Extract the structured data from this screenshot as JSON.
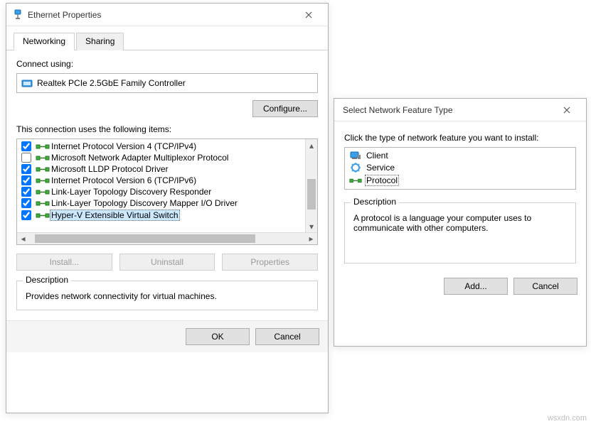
{
  "ethernet": {
    "title": "Ethernet Properties",
    "tabs": {
      "networking": "Networking",
      "sharing": "Sharing"
    },
    "connect_label": "Connect using:",
    "adapter": "Realtek PCIe 2.5GbE Family Controller",
    "configure_btn": "Configure...",
    "items_label": "This connection uses the following items:",
    "items": [
      {
        "checked": true,
        "name": "Internet Protocol Version 4 (TCP/IPv4)"
      },
      {
        "checked": false,
        "name": "Microsoft Network Adapter Multiplexor Protocol"
      },
      {
        "checked": true,
        "name": "Microsoft LLDP Protocol Driver"
      },
      {
        "checked": true,
        "name": "Internet Protocol Version 6 (TCP/IPv6)"
      },
      {
        "checked": true,
        "name": "Link-Layer Topology Discovery Responder"
      },
      {
        "checked": true,
        "name": "Link-Layer Topology Discovery Mapper I/O Driver"
      },
      {
        "checked": true,
        "name": "Hyper-V Extensible Virtual Switch",
        "selected": true
      }
    ],
    "install_btn": "Install...",
    "uninstall_btn": "Uninstall",
    "properties_btn": "Properties",
    "desc_group": "Description",
    "desc_text": "Provides network connectivity for virtual machines.",
    "ok_btn": "OK",
    "cancel_btn": "Cancel"
  },
  "select_feature": {
    "title": "Select Network Feature Type",
    "header": "Click the type of network feature you want to install:",
    "items": [
      {
        "name": "Client",
        "icon": "client"
      },
      {
        "name": "Service",
        "icon": "service"
      },
      {
        "name": "Protocol",
        "icon": "protocol",
        "selected": true
      }
    ],
    "desc_group": "Description",
    "desc_text": "A protocol is a language your computer uses to communicate with other computers.",
    "add_btn": "Add...",
    "cancel_btn": "Cancel"
  },
  "watermark": "wsxdn.com"
}
